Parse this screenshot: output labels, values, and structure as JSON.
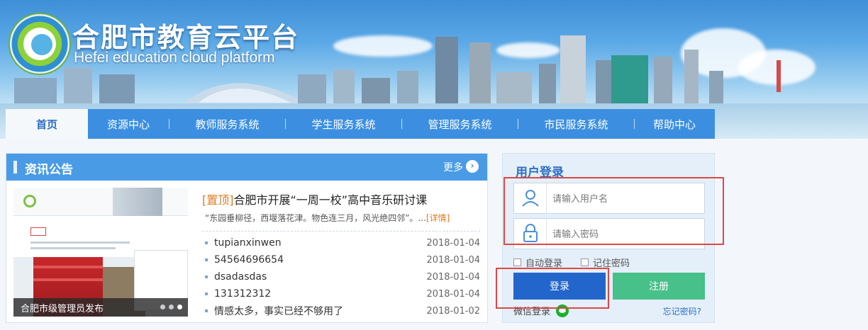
{
  "header": {
    "title": "合肥市教育云平台",
    "subtitle": "Hefei education cloud platform"
  },
  "nav": {
    "items": [
      {
        "label": "首页",
        "active": true
      },
      {
        "label": "资源中心"
      },
      {
        "label": "教师服务系统"
      },
      {
        "label": "学生服务系统"
      },
      {
        "label": "管理服务系统"
      },
      {
        "label": "市民服务系统"
      },
      {
        "label": "帮助中心"
      }
    ]
  },
  "news": {
    "title": "资讯公告",
    "more": "更多",
    "slide_caption": "合肥市级管理员发布",
    "headline_tag": "[置顶]",
    "headline": "合肥市开展“一周一校”高中音乐研讨课",
    "summary": "“东园垂柳径，西堰落花津。物色连三月，风光绝四邻”。...",
    "summary_link": "[详情]",
    "items": [
      {
        "text": "tupianxinwen",
        "date": "2018-01-04"
      },
      {
        "text": "54564696654",
        "date": "2018-01-04"
      },
      {
        "text": "dsadasdas",
        "date": "2018-01-04"
      },
      {
        "text": "131312312",
        "date": "2018-01-04"
      },
      {
        "text": "情感太多，事实已经不够用了",
        "date": "2018-01-02"
      }
    ]
  },
  "login": {
    "title": "用户登录",
    "username_placeholder": "请输入用户名",
    "password_placeholder": "请输入密码",
    "auto_login": "自动登录",
    "remember_password": "记住密码",
    "login_button": "登录",
    "register_button": "注册",
    "wechat_login": "微信登录",
    "forgot_password": "忘记密码?"
  },
  "colors": {
    "nav_bg": "#3c8fe0",
    "panel_header": "#4a9be6",
    "login_button": "#2266cc",
    "register_button": "#48c08a",
    "accent_orange": "#e07a1f",
    "annotation_red": "#e04646"
  }
}
